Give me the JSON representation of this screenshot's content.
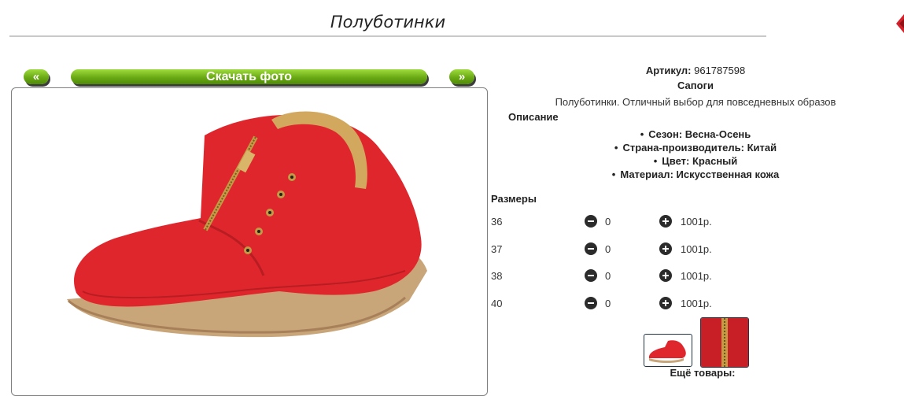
{
  "header": {
    "title": "Полуботинки"
  },
  "gallery": {
    "prev_label": "«",
    "download_label": "Скачать фото",
    "next_label": "»"
  },
  "product": {
    "article_label": "Артикул:",
    "article_value": "961787598",
    "category": "Сапоги",
    "summary": "Полуботинки. Отличный выбор для повседневных образов",
    "description_heading": "Описание",
    "features": [
      "Сезон: Весна-Осень",
      "Страна-производитель: Китай",
      "Цвет: Красный",
      "Материал: Искусственная кожа"
    ]
  },
  "sizes": {
    "heading": "Размеры",
    "rows": [
      {
        "size": "36",
        "qty": "0",
        "price": "1001р."
      },
      {
        "size": "37",
        "qty": "0",
        "price": "1001р."
      },
      {
        "size": "38",
        "qty": "0",
        "price": "1001р."
      },
      {
        "size": "40",
        "qty": "0",
        "price": "1001р."
      }
    ]
  },
  "more": {
    "label": "Ещё товары:"
  },
  "colors": {
    "accent_green": "#6aaa14",
    "shoe_red": "#e0262d",
    "sole": "#c9a57a"
  }
}
